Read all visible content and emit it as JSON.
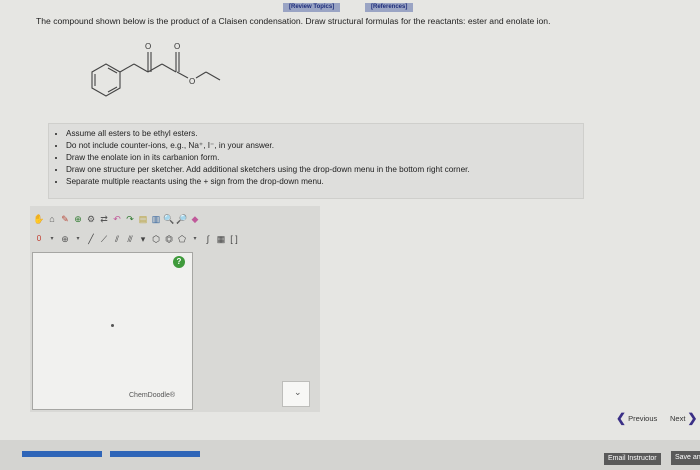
{
  "header": {
    "review_topics_label": "[Review Topics]",
    "references_label": "[References]"
  },
  "question": {
    "text": "The compound shown below is the product of a Claisen condensation. Draw structural formulas for the reactants: ester and enolate ion.",
    "molecule_atom_labels": [
      "O",
      "O",
      "O"
    ]
  },
  "instructions": {
    "items": [
      "Assume all esters to be ethyl esters.",
      "Do not include counter-ions, e.g., Na⁺, I⁻, in your answer.",
      "Draw the enolate ion in its carbanion form.",
      "Draw one structure per sketcher. Add additional sketchers using the drop-down menu in the bottom right corner.",
      "Separate multiple reactants using the + sign from the drop-down menu."
    ]
  },
  "sketcher": {
    "help_label": "?",
    "brand_label": "ChemDoodle®",
    "toolbar_row2_label": "0",
    "dropdown_icon": "chevron-down-icon"
  },
  "navigation": {
    "previous_label": "Previous",
    "next_label": "Next"
  },
  "footer": {
    "email_label": "Email Instructor",
    "save_label": "Save an"
  },
  "colors": {
    "accent_blue": "#2f65b8",
    "nav_arrow": "#3a2f86",
    "help_green": "#3f9a3b"
  }
}
